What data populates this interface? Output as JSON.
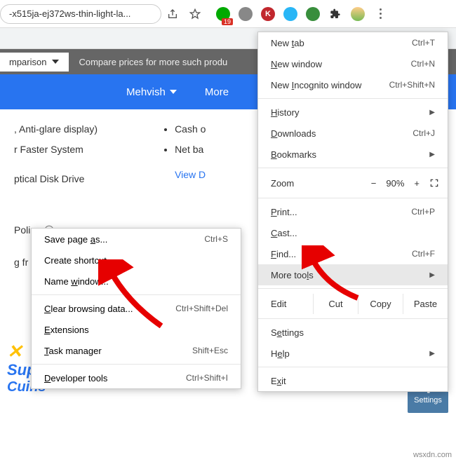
{
  "url": "-x515ja-ej372ws-thin-light-la...",
  "badge": "19",
  "promo": {
    "btn": "mparison",
    "text": "Compare prices for more such produ"
  },
  "bluebar": {
    "user": "Mehvish",
    "more": "More"
  },
  "page": {
    "l1": ", Anti-glare display)",
    "l2": "r Faster System",
    "l3": "ptical Disk Drive",
    "r1": "Cash o",
    "r2": "Net ba",
    "link": "View D",
    "policy": "Policy",
    "frag": "g fr"
  },
  "menu": {
    "newtab": "New tab",
    "newtab_k": "Ctrl+T",
    "newwin": "New window",
    "newwin_k": "Ctrl+N",
    "incog": "New Incognito window",
    "incog_k": "Ctrl+Shift+N",
    "history": "History",
    "downloads": "Downloads",
    "downloads_k": "Ctrl+J",
    "bookmarks": "Bookmarks",
    "zoom": "Zoom",
    "zoom_pct": "90%",
    "print": "Print...",
    "print_k": "Ctrl+P",
    "cast": "Cast...",
    "find": "Find...",
    "find_k": "Ctrl+F",
    "moretools": "More tools",
    "edit": "Edit",
    "cut": "Cut",
    "copy": "Copy",
    "paste": "Paste",
    "settings": "Settings",
    "help": "Help",
    "exit": "Exit"
  },
  "submenu": {
    "save": "Save page as...",
    "save_k": "Ctrl+S",
    "shortcut": "Create shortcut...",
    "namewin": "Name window...",
    "clear": "Clear browsing data...",
    "clear_k": "Ctrl+Shift+Del",
    "ext": "Extensions",
    "task": "Task manager",
    "task_k": "Shift+Esc",
    "dev": "Developer tools",
    "dev_k": "Ctrl+Shift+I"
  },
  "settings_btn": "Settings",
  "watermark": "wsxdn.com"
}
